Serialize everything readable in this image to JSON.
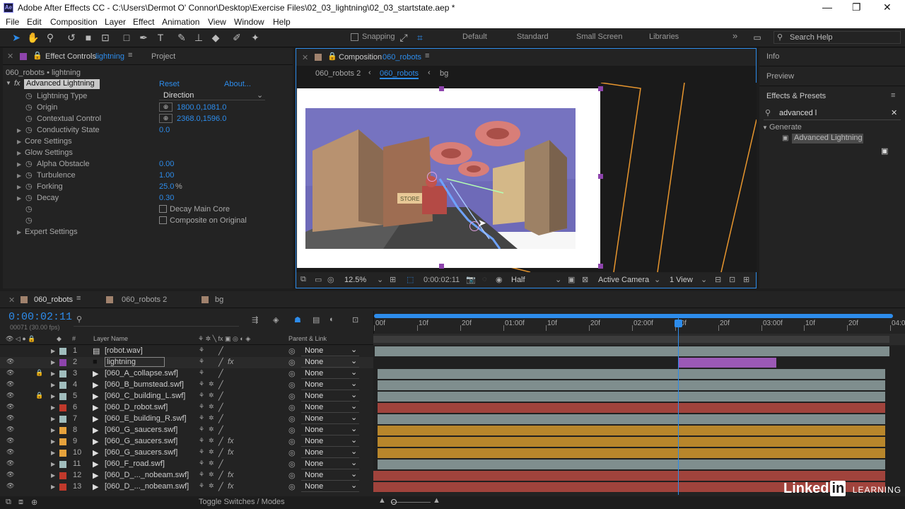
{
  "window": {
    "title": "Adobe After Effects CC - C:\\Users\\Dermot O' Connor\\Desktop\\Exercise Files\\02_03_lightning\\02_03_startstate.aep *",
    "minimize": "—",
    "maximize": "❐",
    "close": "✕",
    "app_icon": "Ae"
  },
  "menu": [
    "File",
    "Edit",
    "Composition",
    "Layer",
    "Effect",
    "Animation",
    "View",
    "Window",
    "Help"
  ],
  "toolbar": {
    "snapping": "Snapping",
    "workspaces": [
      "Default",
      "Standard",
      "Small Screen",
      "Libraries"
    ],
    "more": "»",
    "search_placeholder": "Search Help"
  },
  "effect_controls": {
    "tab": "Effect Controls",
    "layer_name": "lightning",
    "project_tab": "Project",
    "subtitle": "060_robots • lightning",
    "effect_name": "Advanced Lightning",
    "reset": "Reset",
    "about": "About...",
    "props": [
      {
        "name": "Lightning Type",
        "value": "Direction",
        "kind": "dropdown"
      },
      {
        "name": "Origin",
        "value": "1800.0,1081.0",
        "kind": "point"
      },
      {
        "name": "Contextual Control",
        "value": "2368.0,1596.0",
        "kind": "point"
      },
      {
        "name": "Conductivity State",
        "value": "0.0",
        "kind": "expand"
      },
      {
        "name": "Core Settings",
        "value": "",
        "kind": "group"
      },
      {
        "name": "Glow Settings",
        "value": "",
        "kind": "group"
      },
      {
        "name": "Alpha Obstacle",
        "value": "0.00",
        "kind": "expand"
      },
      {
        "name": "Turbulence",
        "value": "1.00",
        "kind": "expand"
      },
      {
        "name": "Forking",
        "value": "25.0",
        "unit": "%",
        "kind": "expand"
      },
      {
        "name": "Decay",
        "value": "0.30",
        "kind": "expand"
      },
      {
        "name": "",
        "value": "Decay Main Core",
        "kind": "check"
      },
      {
        "name": "",
        "value": "Composite on Original",
        "kind": "check"
      },
      {
        "name": "Expert Settings",
        "value": "",
        "kind": "group"
      }
    ]
  },
  "composition": {
    "tab": "Composition",
    "comp_name": "060_robots",
    "breadcrumbs": [
      "060_robots 2",
      "060_robots",
      "bg"
    ],
    "store_sign": "STORE",
    "footer": {
      "zoom": "12.5%",
      "timecode": "0:00:02:11",
      "resolution": "Half",
      "camera": "Active Camera",
      "views": "1 View"
    }
  },
  "right_panels": {
    "info": "Info",
    "preview": "Preview",
    "effects_presets": "Effects & Presets",
    "search_value": "advanced l",
    "category": "Generate",
    "result": "Advanced Lightning"
  },
  "timeline": {
    "tabs": [
      "060_robots",
      "060_robots 2",
      "bg"
    ],
    "timecode": "0:00:02:11",
    "frames": "00071 (30.00 fps)",
    "col_layer_name": "Layer Name",
    "col_hash": "#",
    "col_parent": "Parent & Link",
    "ruler": [
      "00f",
      "10f",
      "20f",
      "01:00f",
      "10f",
      "20f",
      "02:00f",
      "10f",
      "20f",
      "03:00f",
      "10f",
      "20f",
      "04:00"
    ],
    "current_time_fraction": 0.59,
    "layers": [
      {
        "num": "1",
        "name": "[robot.wav]",
        "color": "#a0bdbd",
        "type": "audio",
        "parent": "None",
        "fx": false,
        "bar": "#7f8e8e",
        "locked": false,
        "eye": false
      },
      {
        "num": "2",
        "name": "lightning",
        "color": "#8e44ad",
        "type": "solid",
        "parent": "None",
        "fx": true,
        "bar": "#9b59b6",
        "locked": false,
        "eye": true
      },
      {
        "num": "3",
        "name": "[060_A_collapse.swf]",
        "color": "#a0bdbd",
        "type": "swf",
        "parent": "None",
        "fx": false,
        "bar": "#7f8e8e",
        "locked": true,
        "eye": true
      },
      {
        "num": "4",
        "name": "[060_B_bumstead.swf]",
        "color": "#a0bdbd",
        "type": "swf",
        "parent": "None",
        "fx": false,
        "bar": "#7f8e8e",
        "locked": false,
        "eye": true
      },
      {
        "num": "5",
        "name": "[060_C_building_L.swf]",
        "color": "#a0bdbd",
        "type": "swf",
        "parent": "None",
        "fx": false,
        "bar": "#7f8e8e",
        "locked": true,
        "eye": true
      },
      {
        "num": "6",
        "name": "[060_D_robot.swf]",
        "color": "#c0392b",
        "type": "swf",
        "parent": "None",
        "fx": false,
        "bar": "#a0433c",
        "locked": false,
        "eye": true
      },
      {
        "num": "7",
        "name": "[060_E_building_R.swf]",
        "color": "#a0bdbd",
        "type": "swf",
        "parent": "None",
        "fx": false,
        "bar": "#7f8e8e",
        "locked": false,
        "eye": true
      },
      {
        "num": "8",
        "name": "[060_G_saucers.swf]",
        "color": "#e6a23c",
        "type": "swf",
        "parent": "None",
        "fx": false,
        "bar": "#b8862b",
        "locked": false,
        "eye": true
      },
      {
        "num": "9",
        "name": "[060_G_saucers.swf]",
        "color": "#e6a23c",
        "type": "swf",
        "parent": "None",
        "fx": true,
        "bar": "#b8862b",
        "locked": false,
        "eye": true
      },
      {
        "num": "10",
        "name": "[060_G_saucers.swf]",
        "color": "#e6a23c",
        "type": "swf",
        "parent": "None",
        "fx": true,
        "bar": "#b8862b",
        "locked": false,
        "eye": true
      },
      {
        "num": "11",
        "name": "[060_F_road.swf]",
        "color": "#a0bdbd",
        "type": "swf",
        "parent": "None",
        "fx": false,
        "bar": "#7f8e8e",
        "locked": false,
        "eye": true
      },
      {
        "num": "12",
        "name": "[060_D_..._nobeam.swf]",
        "color": "#c0392b",
        "type": "swf",
        "parent": "None",
        "fx": true,
        "bar": "#a0433c",
        "locked": false,
        "eye": true
      },
      {
        "num": "13",
        "name": "[060_D_..._nobeam.swf]",
        "color": "#c0392b",
        "type": "swf",
        "parent": "None",
        "fx": true,
        "bar": "#a0433c",
        "locked": false,
        "eye": true
      }
    ],
    "toggle_label": "Toggle Switches / Modes"
  },
  "watermark": {
    "text": "Linked",
    "in": "in",
    "learning": "LEARNING"
  }
}
